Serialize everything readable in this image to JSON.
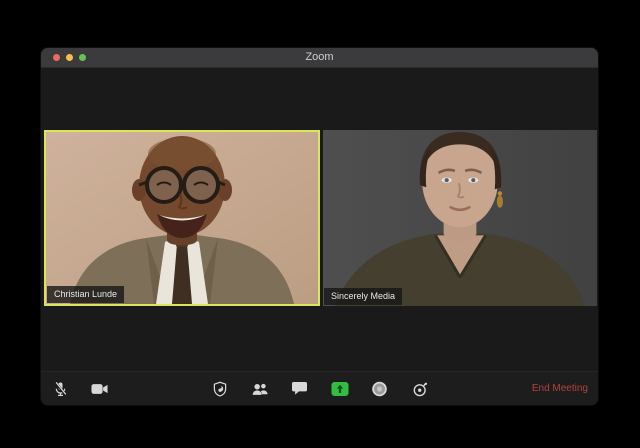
{
  "window": {
    "title": "Zoom",
    "traffic_lights": [
      "close",
      "minimize",
      "fullscreen"
    ]
  },
  "participants": [
    {
      "name": "Christian Lunde",
      "active_speaker": true
    },
    {
      "name": "Sincerely Media",
      "active_speaker": false
    }
  ],
  "toolbar": {
    "buttons": {
      "mute": {
        "icon": "microphone-muted-icon",
        "state": "muted"
      },
      "video": {
        "icon": "video-camera-icon",
        "state": "on"
      },
      "security": {
        "icon": "shield-icon"
      },
      "participants": {
        "icon": "participants-icon"
      },
      "chat": {
        "icon": "chat-bubble-icon"
      },
      "share_screen": {
        "icon": "share-screen-icon"
      },
      "record": {
        "icon": "record-icon"
      },
      "timer": {
        "icon": "stopwatch-icon"
      }
    },
    "end_meeting_label": "End Meeting"
  },
  "colors": {
    "active_speaker_border": "#dbe45c",
    "share_screen_green": "#2fbe41",
    "end_meeting_red": "#b5413f",
    "titlebar_bg": "#3b3b3d",
    "window_bg": "#1a1a1a",
    "traffic_close": "#ec6a5e",
    "traffic_minimize": "#f5bf4f",
    "traffic_fullscreen": "#61c554"
  }
}
